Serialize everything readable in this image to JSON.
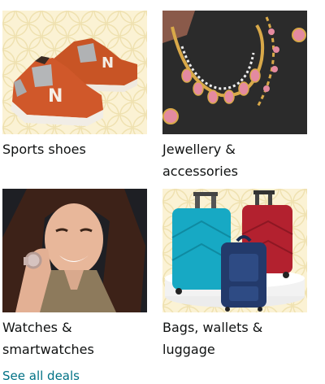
{
  "categories": [
    {
      "label": "Sports shoes",
      "icon": "sports-shoes-image"
    },
    {
      "label": "Jewellery &\naccessories",
      "icon": "jewellery-image"
    },
    {
      "label": "Watches &\nsmartwatches",
      "icon": "watch-model-image"
    },
    {
      "label": "Bags, wallets &\nluggage",
      "icon": "luggage-image"
    }
  ],
  "see_more": {
    "label": "See all deals"
  },
  "colors": {
    "caption": "#0f1111",
    "link": "#007185"
  }
}
